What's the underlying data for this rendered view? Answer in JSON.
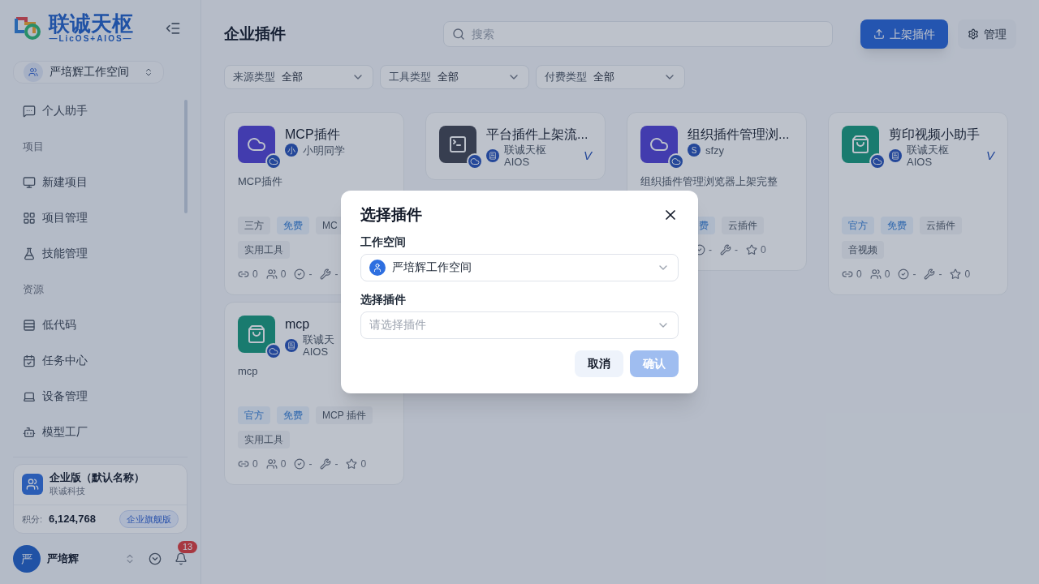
{
  "logo": {
    "name": "联诚天枢",
    "subtitle": "—LicOS+AIOS—"
  },
  "workspace": {
    "name": "严培辉工作空间"
  },
  "nav": [
    {
      "kind": "item",
      "label": "个人助手"
    },
    {
      "kind": "section",
      "label": "项目"
    },
    {
      "kind": "item",
      "label": "新建项目"
    },
    {
      "kind": "item",
      "label": "项目管理"
    },
    {
      "kind": "item",
      "label": "技能管理"
    },
    {
      "kind": "section",
      "label": "资源"
    },
    {
      "kind": "item",
      "label": "低代码"
    },
    {
      "kind": "item",
      "label": "任务中心"
    },
    {
      "kind": "item",
      "label": "设备管理"
    },
    {
      "kind": "item",
      "label": "模型工厂"
    }
  ],
  "org": {
    "name": "企业版（默认名称）",
    "company": "联诚科技",
    "points_label": "积分:",
    "points": "6,124,768",
    "plan": "企业旗舰版"
  },
  "user": {
    "avatar": "严",
    "name": "严培辉",
    "notifications": "13"
  },
  "page": {
    "title": "企业插件",
    "search_placeholder": "搜索",
    "primary_button": "上架插件",
    "secondary_button": "管理"
  },
  "filters": [
    {
      "label": "来源类型",
      "value": "全部"
    },
    {
      "label": "工具类型",
      "value": "全部"
    },
    {
      "label": "付费类型",
      "value": "全部"
    }
  ],
  "cards": [
    {
      "kind": "cloud",
      "title": "MCP插件",
      "author_initial": "小",
      "author": "小明同学",
      "description": "MCP插件",
      "tags": [
        {
          "label": "三方",
          "highlighted": false
        },
        {
          "label": "免费",
          "highlighted": true
        },
        {
          "label": "MC",
          "highlighted": false
        },
        {
          "label": "实用工具",
          "highlighted": false
        }
      ],
      "stats": [
        {
          "kind": "link",
          "value": "0"
        },
        {
          "kind": "users",
          "value": "0"
        },
        {
          "kind": "check",
          "value": "-"
        },
        {
          "kind": "wrench",
          "value": "-"
        }
      ]
    },
    {
      "kind": "terminal",
      "title": "平台插件上架流...",
      "author": "联诚天枢 AIOS",
      "badge": "V"
    },
    {
      "kind": "cloud",
      "title": "组织插件管理浏...",
      "author_initial": "S",
      "author": "sfzy",
      "description": "组织插件管理浏览器上架完整",
      "partly_hidden": true,
      "tags": [
        {
          "label": "费",
          "highlighted": true
        },
        {
          "label": "云插件",
          "highlighted": false
        }
      ],
      "stats": [
        {
          "kind": "check",
          "value": "-"
        },
        {
          "kind": "wrench",
          "value": "-"
        },
        {
          "kind": "star",
          "value": "0"
        }
      ]
    },
    {
      "kind": "bag",
      "title": "剪印视频小助手",
      "author": "联诚天枢 AIOS",
      "badge": "V",
      "tags": [
        {
          "label": "官方",
          "highlighted": true
        },
        {
          "label": "免费",
          "highlighted": true
        },
        {
          "label": "云插件",
          "highlighted": false
        },
        {
          "label": "音视频",
          "highlighted": false
        }
      ],
      "stats": [
        {
          "kind": "link",
          "value": "0"
        },
        {
          "kind": "users",
          "value": "0"
        },
        {
          "kind": "check",
          "value": "-"
        },
        {
          "kind": "wrench",
          "value": "-"
        },
        {
          "kind": "star",
          "value": "0"
        }
      ]
    },
    {
      "kind": "bag",
      "title": "mcp",
      "author": "联诚天 AIOS",
      "description": "mcp",
      "tags": [
        {
          "label": "官方",
          "highlighted": true
        },
        {
          "label": "免费",
          "highlighted": true
        },
        {
          "label": "MCP 插件",
          "highlighted": false
        },
        {
          "label": "实用工具",
          "highlighted": false
        }
      ],
      "stats": [
        {
          "kind": "link",
          "value": "0"
        },
        {
          "kind": "users",
          "value": "0"
        },
        {
          "kind": "check",
          "value": "-"
        },
        {
          "kind": "wrench",
          "value": "-"
        },
        {
          "kind": "star",
          "value": "0"
        }
      ]
    }
  ],
  "dialog": {
    "title": "选择插件",
    "workspace_label": "工作空间",
    "workspace_value": "严培辉工作空间",
    "plugin_label": "选择插件",
    "plugin_placeholder": "请选择插件",
    "cancel": "取消",
    "confirm": "确认",
    "confirm_disabled": true
  }
}
